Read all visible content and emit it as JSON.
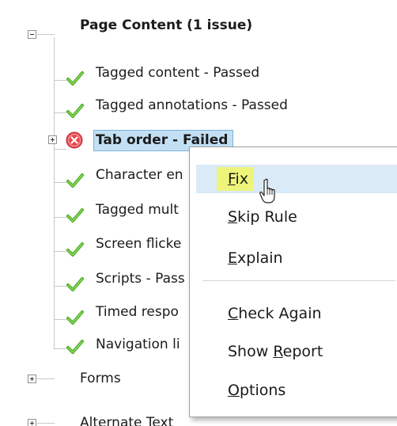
{
  "tree": {
    "page_content": {
      "label": "Page Content (1 issue)"
    },
    "items": [
      {
        "label": "Tagged content - Passed",
        "status": "passed"
      },
      {
        "label": "Tagged annotations - Passed",
        "status": "passed"
      },
      {
        "label": "Tab order - Failed",
        "status": "failed"
      },
      {
        "label": "Character en",
        "status": "passed"
      },
      {
        "label": "Tagged mult",
        "status": "passed"
      },
      {
        "label": "Screen flicke",
        "status": "passed"
      },
      {
        "label": "Scripts - Pass",
        "status": "passed"
      },
      {
        "label": "Timed respo",
        "status": "passed"
      },
      {
        "label": "Navigation li",
        "status": "passed"
      }
    ],
    "forms": {
      "label": "Forms"
    },
    "alternate_text": {
      "label": "Alternate Text"
    }
  },
  "context_menu": {
    "fix": {
      "pre": "",
      "mnemonic": "F",
      "post": "ix"
    },
    "skip_rule": {
      "pre": "",
      "mnemonic": "S",
      "post": "kip Rule"
    },
    "explain": {
      "pre": "",
      "mnemonic": "E",
      "post": "xplain"
    },
    "check_again": {
      "pre": "",
      "mnemonic": "C",
      "post": "heck Again"
    },
    "show_report": {
      "pre": "Show ",
      "mnemonic": "R",
      "post": "eport"
    },
    "options": {
      "pre": "",
      "mnemonic": "O",
      "post": "ptions"
    }
  },
  "colors": {
    "check_green": "#4caf1f",
    "error_red": "#e8454e",
    "selection": "#c3dff4",
    "menu_highlight": "#dbeaf7",
    "fix_highlighter": "#eef47a"
  },
  "icons": {
    "passed": "green-check-icon",
    "failed": "red-x-circle-icon",
    "expander": "plus-box-icon",
    "collapser": "minus-box-icon",
    "cursor": "mouse-pointer-icon"
  }
}
